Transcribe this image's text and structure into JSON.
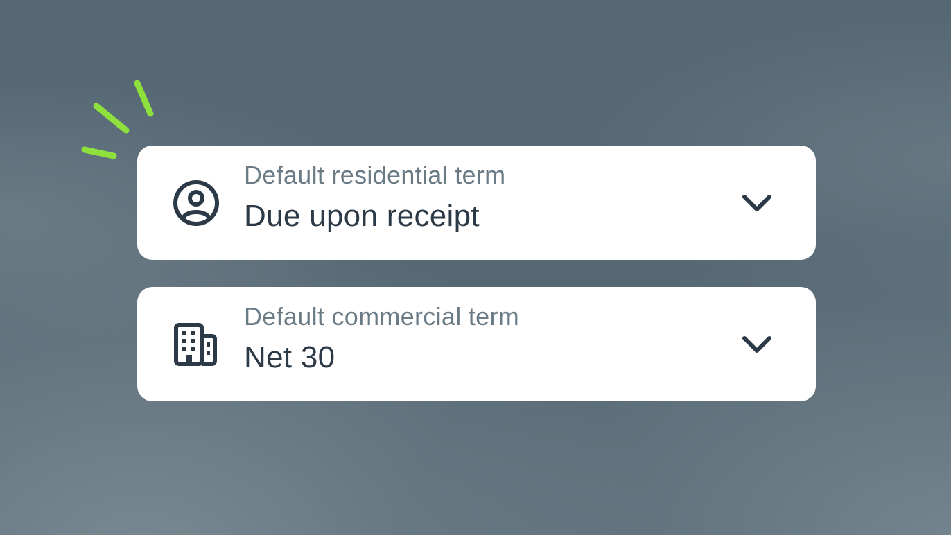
{
  "colors": {
    "background": "#566874",
    "card": "#ffffff",
    "icon": "#2b3a46",
    "label": "#6b7b86",
    "value": "#2b3a46",
    "accent": "#8ee03c"
  },
  "decoration": {
    "icon": "sparkle-lines-icon"
  },
  "fields": [
    {
      "icon": "user-circle-icon",
      "label": "Default residential term",
      "value": "Due upon receipt",
      "dropdown_icon": "chevron-down-icon"
    },
    {
      "icon": "building-icon",
      "label": "Default commercial term",
      "value": "Net 30",
      "dropdown_icon": "chevron-down-icon"
    }
  ]
}
